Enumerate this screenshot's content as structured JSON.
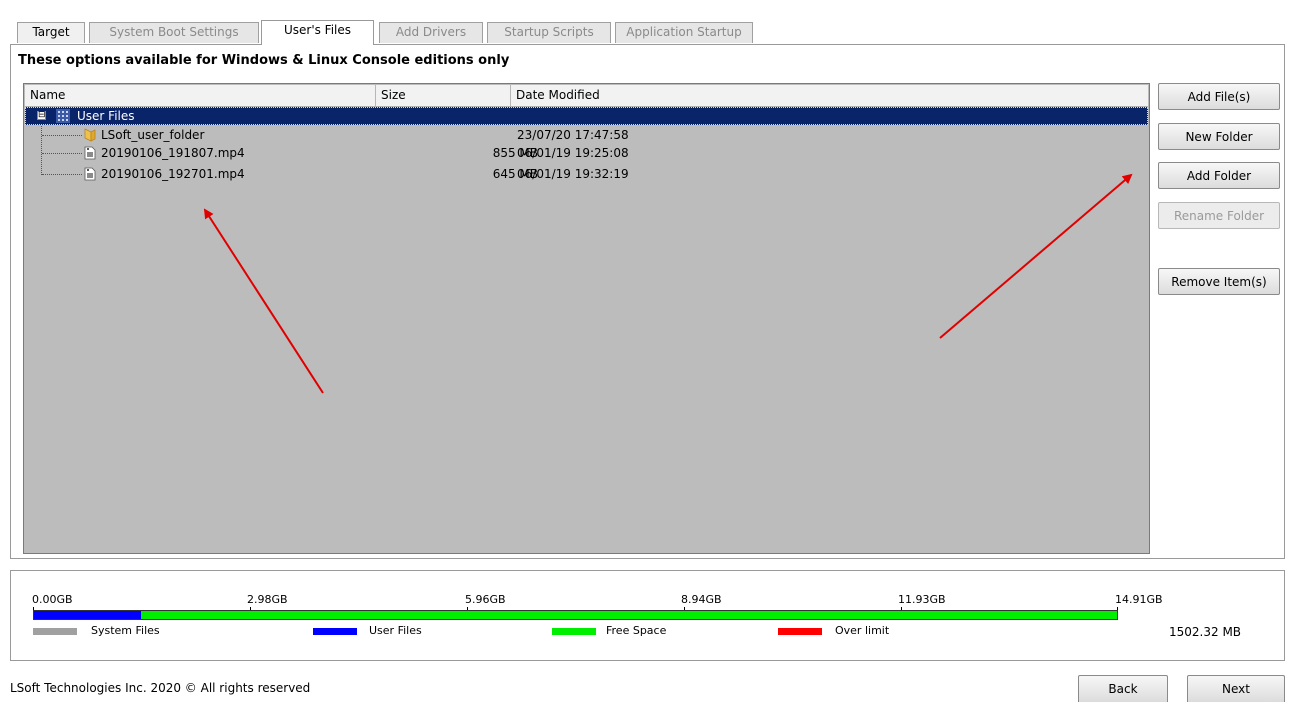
{
  "tabs": [
    {
      "label": "Target",
      "state": "enabled"
    },
    {
      "label": "System Boot Settings",
      "state": "disabled"
    },
    {
      "label": "User's Files",
      "state": "active"
    },
    {
      "label": "Add Drivers",
      "state": "disabled"
    },
    {
      "label": "Startup Scripts",
      "state": "disabled"
    },
    {
      "label": "Application Startup",
      "state": "disabled"
    }
  ],
  "panel": {
    "heading": "These options available for Windows & Linux Console editions only"
  },
  "listview": {
    "columns": [
      "Name",
      "Size",
      "Date Modified"
    ],
    "root": {
      "name": "User Files",
      "expander": "⊟",
      "icon": "grid-folder-icon"
    },
    "items": [
      {
        "name": "LSoft_user_folder",
        "size": "",
        "modified": "23/07/20 17:47:58",
        "icon": "folder-icon"
      },
      {
        "name": "20190106_191807.mp4",
        "size": "855 MB",
        "modified": "06/01/19 19:25:08",
        "icon": "video-file-icon"
      },
      {
        "name": "20190106_192701.mp4",
        "size": "645 MB",
        "modified": "06/01/19 19:32:19",
        "icon": "video-file-icon"
      }
    ]
  },
  "buttons": {
    "add_files": "Add File(s)",
    "new_folder": "New Folder",
    "add_folder": "Add Folder",
    "rename_folder": "Rename Folder",
    "remove_items": "Remove Item(s)"
  },
  "usage": {
    "ticks": [
      "0.00GB",
      "2.98GB",
      "5.96GB",
      "8.94GB",
      "11.93GB",
      "14.91GB"
    ],
    "legend": [
      {
        "label": "System Files",
        "color": "#a0a0a0"
      },
      {
        "label": "User Files",
        "color": "#0000ff"
      },
      {
        "label": "Free Space",
        "color": "#00ee00"
      },
      {
        "label": "Over limit",
        "color": "#ff0000"
      }
    ],
    "total_gb": 14.91,
    "user_files_gb": 1.47,
    "user_files_size": "1502.32 MB"
  },
  "footer": {
    "copyright": "LSoft Technologies Inc. 2020 © All rights reserved",
    "back": "Back",
    "next": "Next"
  },
  "colors": {
    "selection": "#0a246a",
    "listview_bg": "#bcbcbc",
    "annotation_arrow": "#e00000"
  }
}
